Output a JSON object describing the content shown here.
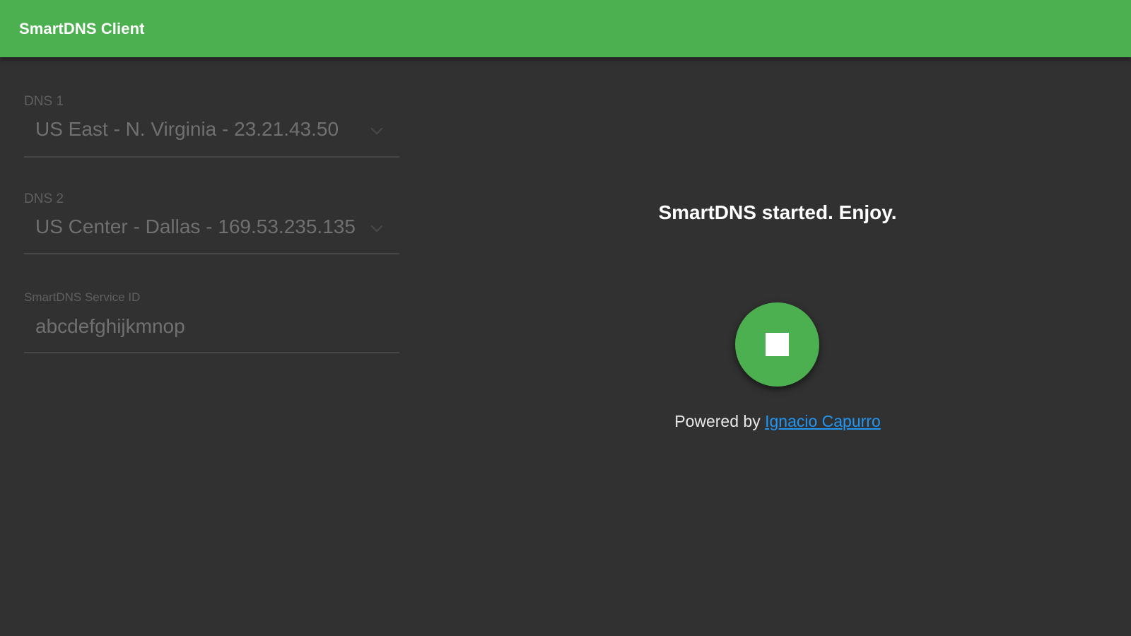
{
  "app": {
    "title": "SmartDNS Client",
    "accent_color": "#4caf50",
    "background_color": "#313131"
  },
  "form": {
    "dns1": {
      "label": "DNS 1",
      "selected": "US East - N. Virginia - 23.21.43.50"
    },
    "dns2": {
      "label": "DNS 2",
      "selected": "US Center - Dallas - 169.53.235.135"
    },
    "service_id": {
      "label": "SmartDNS Service ID",
      "value": "abcdefghijkmnop"
    }
  },
  "status": {
    "message": "SmartDNS started. Enjoy.",
    "action_icon": "stop-icon",
    "powered_prefix": "Powered by",
    "author_link": "Ignacio Capurro",
    "link_color": "#2196f3"
  }
}
